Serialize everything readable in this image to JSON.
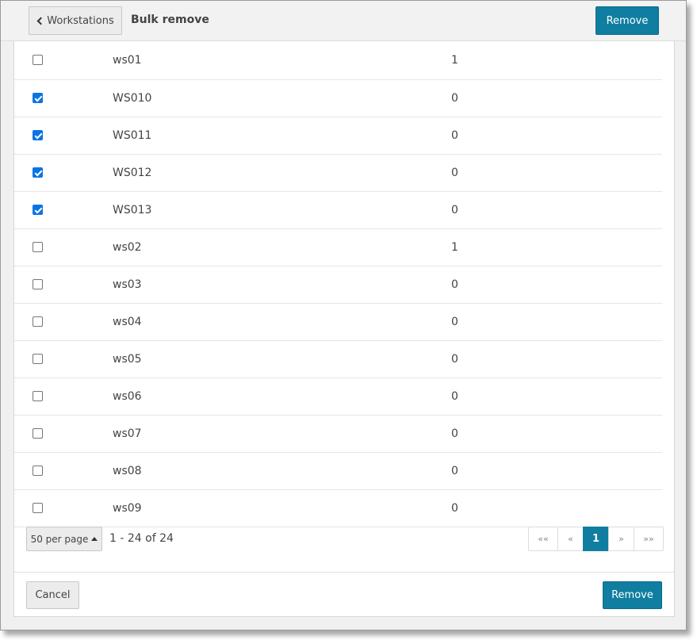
{
  "header": {
    "back_label": "Workstations",
    "title": "Bulk remove",
    "remove_label": "Remove"
  },
  "rows": [
    {
      "name": "ws01",
      "count": "1",
      "checked": false
    },
    {
      "name": "WS010",
      "count": "0",
      "checked": true
    },
    {
      "name": "WS011",
      "count": "0",
      "checked": true
    },
    {
      "name": "WS012",
      "count": "0",
      "checked": true
    },
    {
      "name": "WS013",
      "count": "0",
      "checked": true
    },
    {
      "name": "ws02",
      "count": "1",
      "checked": false
    },
    {
      "name": "ws03",
      "count": "0",
      "checked": false
    },
    {
      "name": "ws04",
      "count": "0",
      "checked": false
    },
    {
      "name": "ws05",
      "count": "0",
      "checked": false
    },
    {
      "name": "ws06",
      "count": "0",
      "checked": false
    },
    {
      "name": "ws07",
      "count": "0",
      "checked": false
    },
    {
      "name": "ws08",
      "count": "0",
      "checked": false
    },
    {
      "name": "ws09",
      "count": "0",
      "checked": false
    }
  ],
  "pagination": {
    "per_page_label": "50 per page",
    "range_text": "1 - 24 of 24",
    "first": "««",
    "prev": "«",
    "current": "1",
    "next": "»",
    "last": "»»"
  },
  "footer": {
    "cancel_label": "Cancel",
    "remove_label": "Remove"
  },
  "colors": {
    "primary": "#0f7ea0",
    "checkbox": "#0b74e5"
  }
}
